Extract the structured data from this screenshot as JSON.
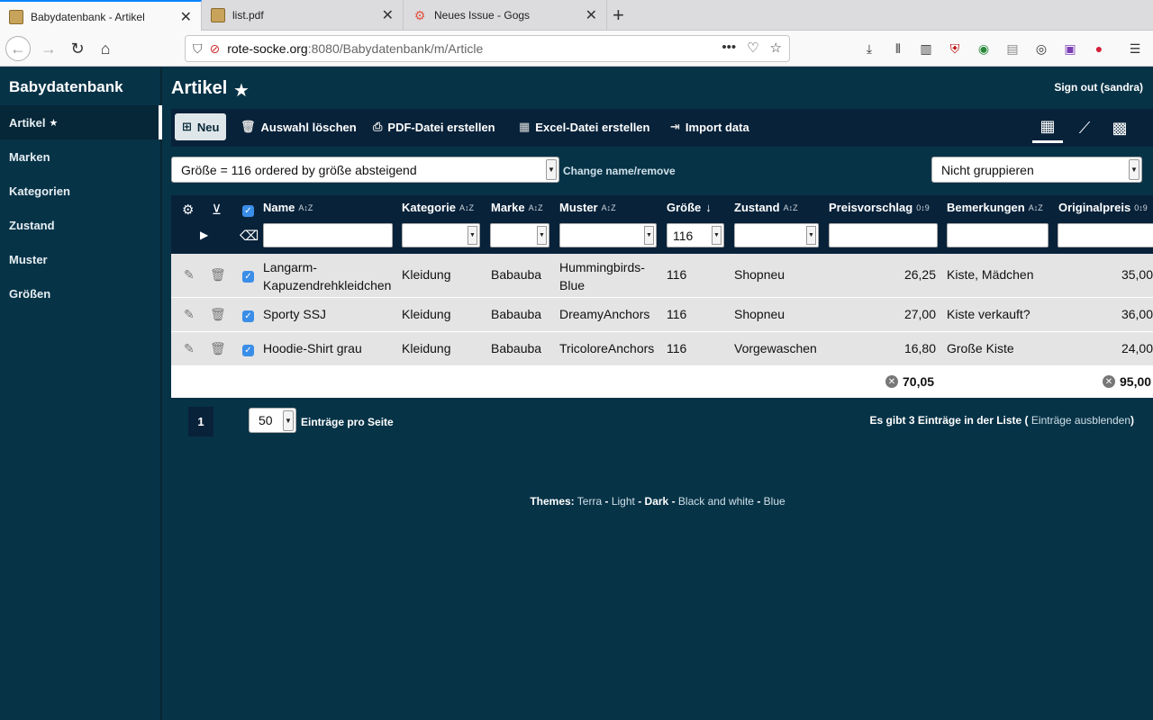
{
  "browser": {
    "tabs": [
      {
        "title": "Babydatenbank - Artikel",
        "active": true
      },
      {
        "title": "list.pdf",
        "active": false
      },
      {
        "title": "Neues Issue - Gogs",
        "active": false
      }
    ],
    "url_host": "rote-socke.org",
    "url_rest": ":8080/Babydatenbank/m/Article"
  },
  "sidebar": {
    "brand": "Babydatenbank",
    "items": [
      {
        "label": "Artikel",
        "active": true
      },
      {
        "label": "Marken"
      },
      {
        "label": "Kategorien"
      },
      {
        "label": "Zustand"
      },
      {
        "label": "Muster"
      },
      {
        "label": "Größen"
      }
    ]
  },
  "header": {
    "title": "Artikel",
    "signout": "Sign out (sandra)"
  },
  "toolbar": {
    "new": "Neu",
    "delete_selection": "Auswahl löschen",
    "pdf": "PDF-Datei erstellen",
    "excel": "Excel-Datei erstellen",
    "import": "Import data"
  },
  "filter": {
    "saved_filter": "Größe = 116 ordered by größe absteigend",
    "change_name": "Change name/remove",
    "grouping": "Nicht gruppieren"
  },
  "table": {
    "columns": [
      "Name",
      "Kategorie",
      "Marke",
      "Muster",
      "Größe",
      "Zustand",
      "Preisvorschlag",
      "Bemerkungen",
      "Originalpreis"
    ],
    "size_filter_value": "116",
    "rows": [
      {
        "name_line1": "Langarm-",
        "name_line2": "Kapuzendrehkleidchen",
        "kategorie": "Kleidung",
        "marke": "Babauba",
        "muster_line1": "Hummingbirds-",
        "muster_line2": "Blue",
        "groesse": "116",
        "zustand": "Shopneu",
        "preisvorschlag": "26,25",
        "bemerkungen": "Kiste, Mädchen",
        "originalpreis": "35,00"
      },
      {
        "name": "Sporty SSJ",
        "kategorie": "Kleidung",
        "marke": "Babauba",
        "muster": "DreamyAnchors",
        "groesse": "116",
        "zustand": "Shopneu",
        "preisvorschlag": "27,00",
        "bemerkungen": "Kiste verkauft?",
        "originalpreis": "36,00"
      },
      {
        "name": "Hoodie-Shirt grau",
        "kategorie": "Kleidung",
        "marke": "Babauba",
        "muster": "TricoloreAnchors",
        "groesse": "116",
        "zustand": "Vorgewaschen",
        "preisvorschlag": "16,80",
        "bemerkungen": "Große Kiste",
        "originalpreis": "24,00"
      }
    ],
    "totals": {
      "preisvorschlag": "70,05",
      "originalpreis": "95,00"
    }
  },
  "pagination": {
    "page": "1",
    "per_page": "50",
    "per_page_label": "Einträge pro Seite",
    "count_text": "Es gibt 3 Einträge in der Liste (",
    "hide_link": "Einträge ausblenden",
    "count_close": ")"
  },
  "themes": {
    "label": "Themes:",
    "items": [
      "Terra",
      "Light",
      "Dark",
      "Black and white",
      "Blue"
    ],
    "active": "Dark"
  }
}
